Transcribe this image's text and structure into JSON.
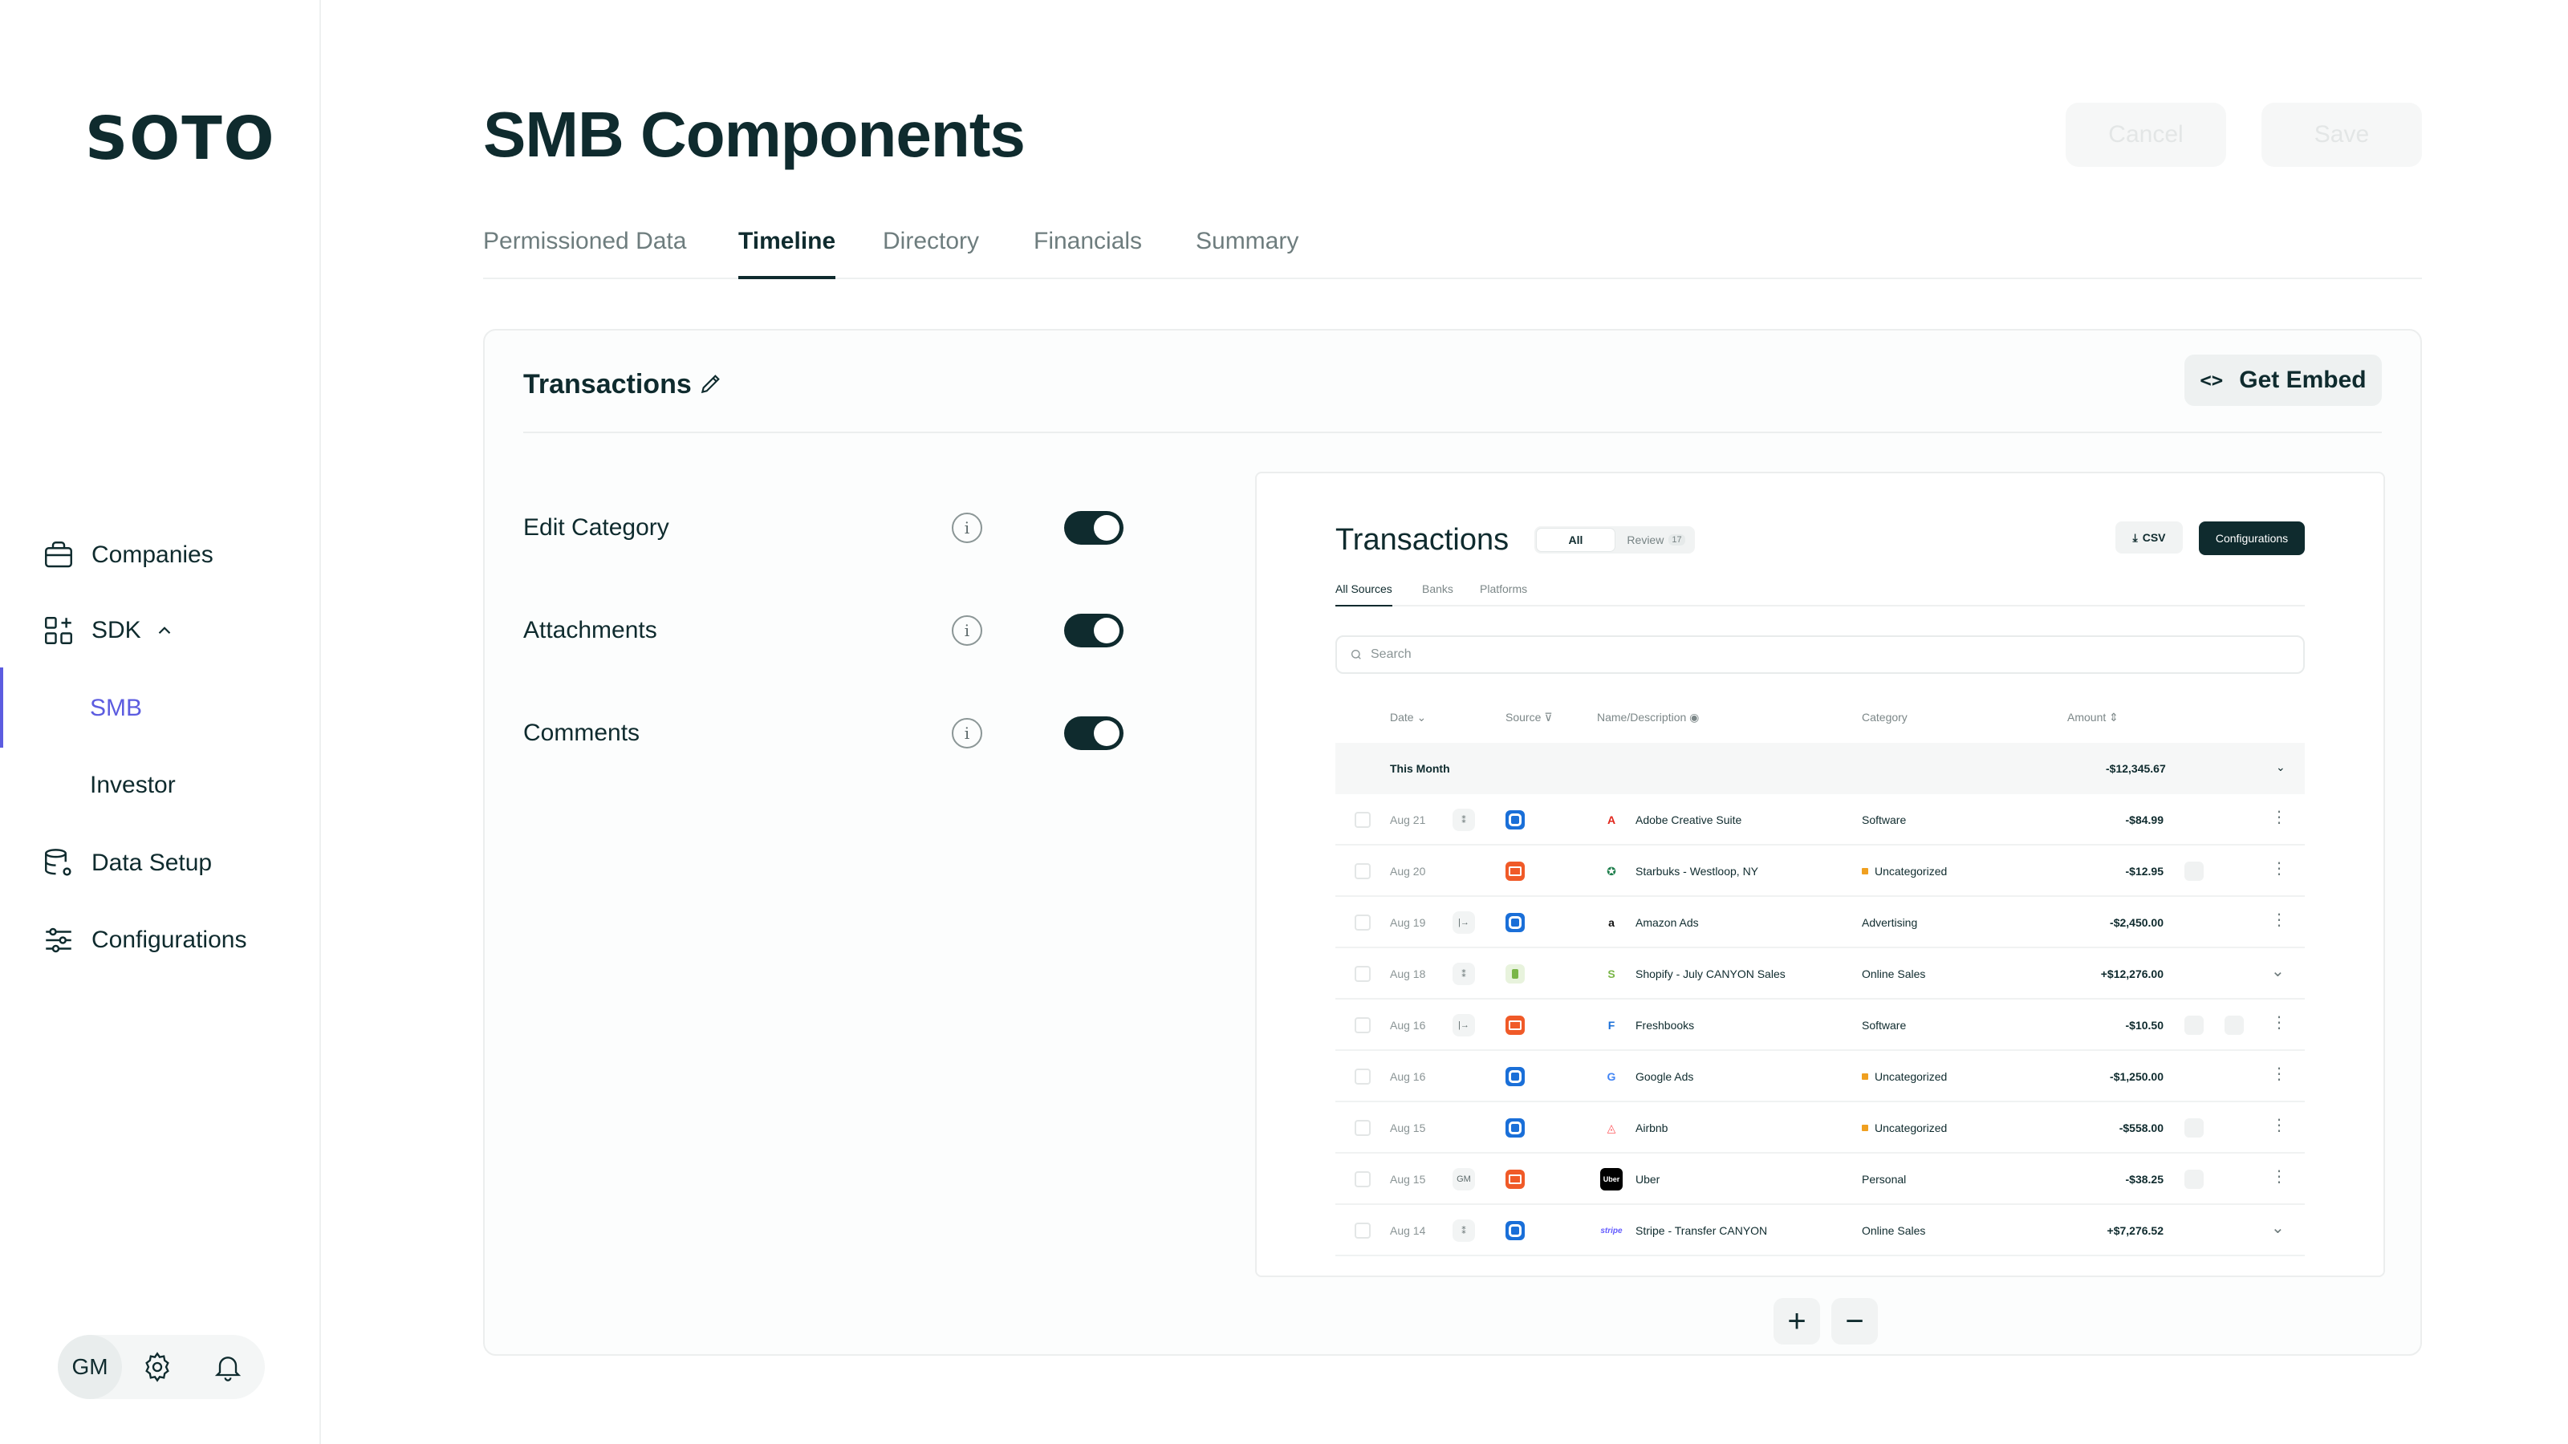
{
  "app": {
    "logo": "SOTO"
  },
  "sidebar": {
    "items": [
      {
        "label": "Companies",
        "icon": "briefcase-icon"
      },
      {
        "label": "SDK",
        "icon": "grid-plus-icon"
      },
      {
        "label": "SMB"
      },
      {
        "label": "Investor"
      },
      {
        "label": "Data Setup",
        "icon": "database-gear-icon"
      },
      {
        "label": "Configurations",
        "icon": "sliders-icon"
      }
    ],
    "avatar": "GM"
  },
  "header": {
    "title": "SMB Components",
    "cancel_label": "Cancel",
    "save_label": "Save"
  },
  "tabs": [
    {
      "label": "Permissioned Data"
    },
    {
      "label": "Timeline"
    },
    {
      "label": "Directory"
    },
    {
      "label": "Financials"
    },
    {
      "label": "Summary"
    }
  ],
  "card": {
    "title": "Transactions",
    "embed_label": "Get Embed",
    "options": [
      {
        "label": "Edit Category",
        "enabled": true
      },
      {
        "label": "Attachments",
        "enabled": true
      },
      {
        "label": "Comments",
        "enabled": true
      }
    ]
  },
  "preview": {
    "title": "Transactions",
    "seg_all": "All",
    "seg_review": "Review",
    "review_count": "17",
    "csv_label": "CSV",
    "config_label": "Configurations",
    "subtabs": [
      "All Sources",
      "Banks",
      "Platforms"
    ],
    "search_placeholder": "Search",
    "columns": [
      "Date",
      "Source",
      "Name/Description",
      "Category",
      "Amount"
    ],
    "group": {
      "label": "This Month",
      "amount": "-$12,345.67"
    },
    "rows": [
      {
        "date": "Aug 21",
        "marker": "⁑",
        "source": "blue",
        "logo": "A",
        "logo_color": "#e1251b",
        "name": "Adobe Creative Suite",
        "category": "Software",
        "flag": false,
        "amount": "-$84.99",
        "comment": false,
        "attach": false,
        "expand": false
      },
      {
        "date": "Aug 20",
        "marker": "",
        "source": "orange",
        "logo": "✪",
        "logo_color": "#1e7e4c",
        "name": "Starbuks - Westloop, NY",
        "category": "Uncategorized",
        "flag": true,
        "amount": "-$12.95",
        "comment": true,
        "attach": false,
        "expand": false
      },
      {
        "date": "Aug 19",
        "marker": "|→",
        "source": "blue",
        "logo": "a",
        "logo_color": "#111111",
        "name": "Amazon Ads",
        "category": "Advertising",
        "flag": false,
        "amount": "-$2,450.00",
        "comment": false,
        "attach": false,
        "expand": false
      },
      {
        "date": "Aug 18",
        "marker": "⁑",
        "source": "green",
        "logo": "S",
        "logo_color": "#7ab648",
        "name": "Shopify - July CANYON Sales",
        "category": "Online Sales",
        "flag": false,
        "amount": "+$12,276.00",
        "comment": false,
        "attach": false,
        "expand": true
      },
      {
        "date": "Aug 16",
        "marker": "|→",
        "source": "orange",
        "logo": "F",
        "logo_color": "#1a6fd8",
        "name": "Freshbooks",
        "category": "Software",
        "flag": false,
        "amount": "-$10.50",
        "comment": true,
        "attach": true,
        "expand": false
      },
      {
        "date": "Aug 16",
        "marker": "",
        "source": "blue",
        "logo": "G",
        "logo_color": "#4285f4",
        "name": "Google Ads",
        "category": "Uncategorized",
        "flag": true,
        "amount": "-$1,250.00",
        "comment": false,
        "attach": false,
        "expand": false
      },
      {
        "date": "Aug 15",
        "marker": "",
        "source": "blue",
        "logo": "◬",
        "logo_color": "#ff5a5f",
        "name": "Airbnb",
        "category": "Uncategorized",
        "flag": true,
        "amount": "-$558.00",
        "comment": true,
        "attach": false,
        "expand": false
      },
      {
        "date": "Aug 15",
        "marker": "GM",
        "source": "orange",
        "logo": "Uber",
        "logo_color": "#000000",
        "name": "Uber",
        "category": "Personal",
        "flag": false,
        "amount": "-$38.25",
        "comment": true,
        "attach": false,
        "expand": false
      },
      {
        "date": "Aug 14",
        "marker": "⁑",
        "source": "blue",
        "logo": "stripe",
        "logo_color": "#635bff",
        "name": "Stripe - Transfer CANYON",
        "category": "Online Sales",
        "flag": false,
        "amount": "+$7,276.52",
        "comment": false,
        "attach": false,
        "expand": true
      }
    ]
  },
  "zoom": {
    "in": "+",
    "out": "−"
  },
  "colors": {
    "primary": "#0f2b2e",
    "accent": "#5c5ce0"
  }
}
